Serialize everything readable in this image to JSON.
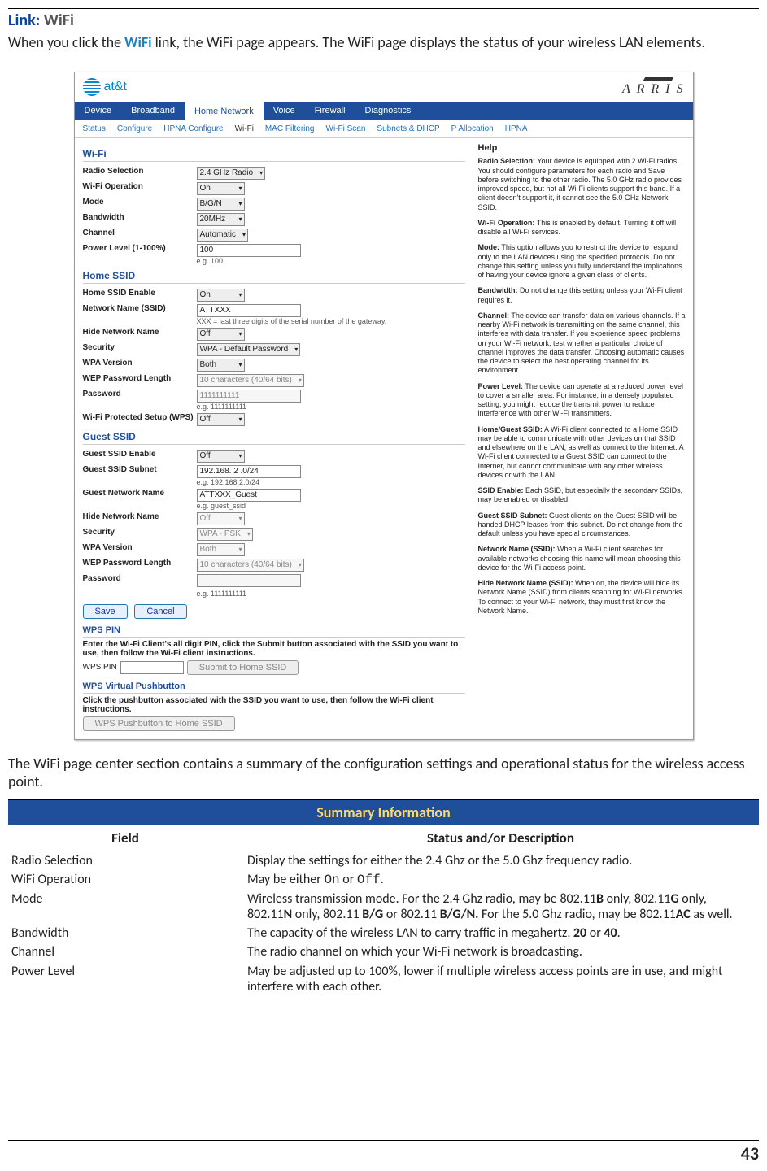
{
  "heading": {
    "prefix": "Link: ",
    "value": "WiFi"
  },
  "intro": {
    "pre": "When you click the ",
    "link": "WiFi",
    "post": " link, the WiFi page appears. The WiFi page displays the status of your wireless LAN elements."
  },
  "screenshot": {
    "brand_att": "at&t",
    "brand_arris": "A R R I S",
    "main_tabs": [
      "Device",
      "Broadband",
      "Home Network",
      "Voice",
      "Firewall",
      "Diagnostics"
    ],
    "main_tab_active": "Home Network",
    "sub_tabs": [
      "Status",
      "Configure",
      "HPNA Configure",
      "Wi-Fi",
      "MAC Filtering",
      "Wi-Fi Scan",
      "Subnets & DHCP",
      "P Allocation",
      "HPNA"
    ],
    "sub_tab_active": "Wi-Fi",
    "left": {
      "wifi_heading": "Wi-Fi",
      "rows_wifi": [
        {
          "label": "Radio Selection",
          "ctl": "2.4 GHz Radio",
          "type": "sel"
        },
        {
          "label": "Wi-Fi Operation",
          "ctl": "On",
          "type": "sel"
        },
        {
          "label": "Mode",
          "ctl": "B/G/N",
          "type": "sel"
        },
        {
          "label": "Bandwidth",
          "ctl": "20MHz",
          "type": "sel"
        },
        {
          "label": "Channel",
          "ctl": "Automatic",
          "type": "sel"
        },
        {
          "label": "Power Level (1-100%)",
          "ctl": "100",
          "type": "inp",
          "hint": "e.g. 100"
        }
      ],
      "home_heading": "Home SSID",
      "rows_home": [
        {
          "label": "Home SSID Enable",
          "ctl": "On",
          "type": "sel"
        },
        {
          "label": "Network Name (SSID)",
          "ctl": "ATTXXX",
          "type": "inp",
          "hint": "XXX = last three digits of the serial number of the gateway."
        },
        {
          "label": "Hide Network Name",
          "ctl": "Off",
          "type": "sel"
        },
        {
          "label": "Security",
          "ctl": "WPA - Default Password",
          "type": "sel"
        },
        {
          "label": "WPA Version",
          "ctl": "Both",
          "type": "sel"
        },
        {
          "label": "WEP Password Length",
          "ctl": "10 characters (40/64 bits)",
          "type": "sel",
          "disabled": true
        },
        {
          "label": "Password",
          "ctl": "1111111111",
          "type": "inp",
          "disabled": true,
          "hint": "e.g. 1111111111"
        },
        {
          "label": "Wi-Fi Protected Setup (WPS)",
          "ctl": "Off",
          "type": "sel"
        }
      ],
      "guest_heading": "Guest SSID",
      "rows_guest": [
        {
          "label": "Guest SSID Enable",
          "ctl": "Off",
          "type": "sel"
        },
        {
          "label": "Guest SSID Subnet",
          "ctl": "192.168. 2       .0/24",
          "type": "inp",
          "hint": "e.g. 192.168.2.0/24"
        },
        {
          "label": "Guest Network Name",
          "ctl": "ATTXXX_Guest",
          "type": "inp",
          "hint": "e.g. guest_ssid"
        },
        {
          "label": "Hide Network Name",
          "ctl": "Off",
          "type": "sel",
          "disabled": true
        },
        {
          "label": "Security",
          "ctl": "WPA - PSK",
          "type": "sel",
          "disabled": true
        },
        {
          "label": "WPA Version",
          "ctl": "Both",
          "type": "sel",
          "disabled": true
        },
        {
          "label": "WEP Password Length",
          "ctl": "10 characters (40/64 bits)",
          "type": "sel",
          "disabled": true
        },
        {
          "label": "Password",
          "ctl": "",
          "type": "inp",
          "disabled": true,
          "hint": "e.g. 1111111111"
        }
      ],
      "save": "Save",
      "cancel": "Cancel",
      "wps_pin_heading": "WPS PIN",
      "wps_pin_text": "Enter the Wi-Fi Client's all digit PIN, click the Submit button associated with the SSID you want to use, then follow the Wi-Fi client instructions.",
      "wps_pin_label": "WPS PIN",
      "wps_pin_btn": "Submit to Home SSID",
      "wps_pb_heading": "WPS Virtual Pushbutton",
      "wps_pb_text": "Click the pushbutton associated with the SSID you want to use, then follow the Wi-Fi client instructions.",
      "wps_pb_btn": "WPS Pushbutton to Home SSID"
    },
    "help": {
      "title": "Help",
      "paras": [
        {
          "b": "Radio Selection:",
          "t": " Your device is equipped with 2 Wi-Fi radios. You should configure parameters for each radio and Save before switching to the other radio. The 5.0 GHz radio provides improved speed, but not all Wi-Fi clients support this band. If a client doesn't support it, it cannot see the 5.0 GHz Network SSID."
        },
        {
          "b": "Wi-Fi Operation:",
          "t": " This is enabled by default. Turning it off will disable all Wi-Fi services."
        },
        {
          "b": "Mode:",
          "t": " This option allows you to restrict the device to respond only to the LAN devices using the specified protocols. Do not change this setting unless you fully understand the implications of having your device ignore a given class of clients."
        },
        {
          "b": "Bandwidth:",
          "t": " Do not change this setting unless your Wi-Fi client requires it."
        },
        {
          "b": "Channel:",
          "t": " The device can transfer data on various channels. If a nearby Wi-Fi network is transmitting on the same channel, this interferes with data transfer. If you experience speed problems on your Wi-Fi network, test whether a particular choice of channel improves the data transfer. Choosing automatic causes the device to select the best operating channel for its environment."
        },
        {
          "b": "Power Level:",
          "t": " The device can operate at a reduced power level to cover a smaller area. For instance, in a densely populated setting, you might reduce the transmit power to reduce interference with other Wi-Fi transmitters."
        },
        {
          "b": "Home/Guest SSID:",
          "t": " A Wi-Fi client connected to a Home SSID may be able to communicate with other devices on that SSID and elsewhere on the LAN, as well as connect to the Internet. A Wi-Fi client connected to a Guest SSID can connect to the Internet, but cannot communicate with any other wireless devices or with the LAN."
        },
        {
          "b": "SSID Enable:",
          "t": " Each SSID, but especially the secondary SSIDs, may be enabled or disabled."
        },
        {
          "b": "Guest SSID Subnet:",
          "t": " Guest clients on the Guest SSID will be handed DHCP leases from this subnet. Do not change from the default unless you have special circumstances."
        },
        {
          "b": "Network Name (SSID):",
          "t": " When a Wi-Fi client searches for available networks choosing this name will mean choosing this device for the Wi-Fi access point."
        },
        {
          "b": "Hide Network Name (SSID):",
          "t": " When on, the device will hide its Network Name (SSID) from clients scanning for Wi-Fi networks. To connect to your Wi-Fi network, they must first know the Network Name."
        }
      ]
    }
  },
  "below_para": "The WiFi page center section contains a summary of the configuration settings and operational status for the wireless access point.",
  "table": {
    "banner": "Summary Information",
    "col1": "Field",
    "col2": "Status and/or Description",
    "rows": [
      {
        "f": "Radio Selection",
        "d": "Display the settings for either the 2.4 Ghz or the 5.0 Ghz frequency radio."
      },
      {
        "f": "WiFi Operation",
        "d_pre": "May be either ",
        "code1": "On",
        "mid": " or ",
        "code2": "Off",
        "post": "."
      },
      {
        "f": "Mode",
        "d": "Wireless transmission mode. For the 2.4 Ghz radio, may be 802.11<b>B</b> only, 802.11<b>G</b> only, 802.11<b>N</b> only, 802.11 <b>B/G</b> or 802.11 <b>B/G/N.</b> For the 5.0 Ghz radio, may be 802.11<b>AC</b> as well."
      },
      {
        "f": "Bandwidth",
        "d": "The capacity of the wireless LAN to carry traffic in megahertz, <b>20</b> or <b>40</b>."
      },
      {
        "f": "Channel",
        "d": "The radio channel on which your Wi-Fi network is broadcasting."
      },
      {
        "f": "Power Level",
        "d": "May be adjusted up to 100%, lower if multiple wireless access points are in use, and might interfere with each other."
      }
    ]
  },
  "page_number": "43"
}
